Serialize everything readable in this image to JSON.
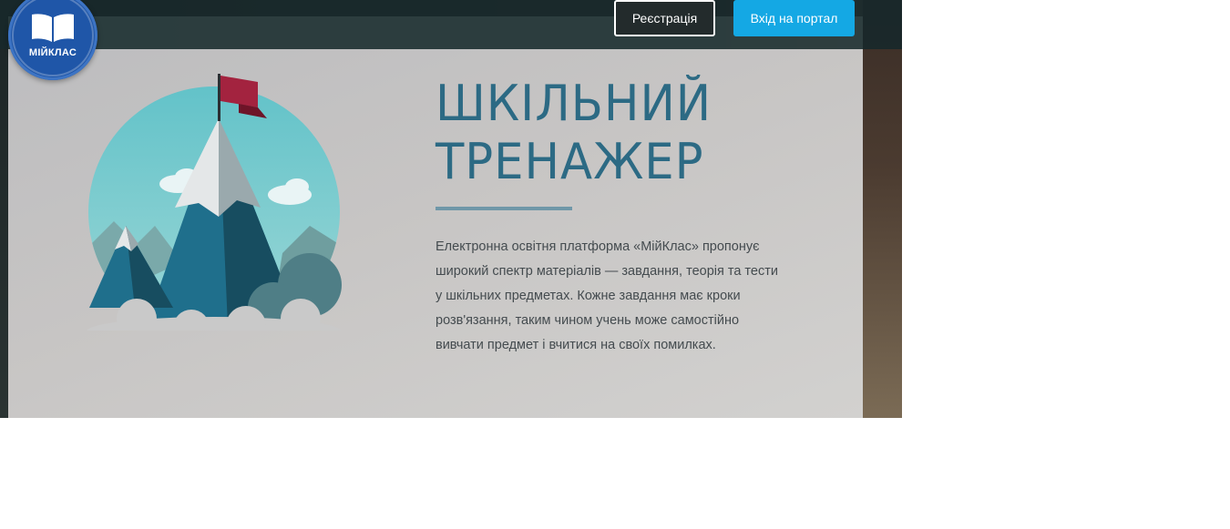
{
  "header": {
    "logo_text": "МІЙКЛАС",
    "register_label": "Реєстрація",
    "login_label": "Вхід на портал"
  },
  "hero": {
    "title_line1": "ШКІЛЬНИЙ",
    "title_line2": "ТРЕНАЖЕР",
    "description": "Електронна освітня платформа «МійКлас» пропонує широкий спектр матеріалів — завдання, теорія та тести у шкільних предметах. Кожне завдання має кроки розв'язання, таким чином учень може самостійно вивчати предмет і вчитися на своїх помилках."
  },
  "colors": {
    "brand_blue": "#1f56a8",
    "login_button": "#14a8e4",
    "title_color": "#2c6a84",
    "flag_red": "#a3233f"
  },
  "icons": {
    "logo": "open-book-icon",
    "illustration": "mountain-flag-illustration"
  }
}
